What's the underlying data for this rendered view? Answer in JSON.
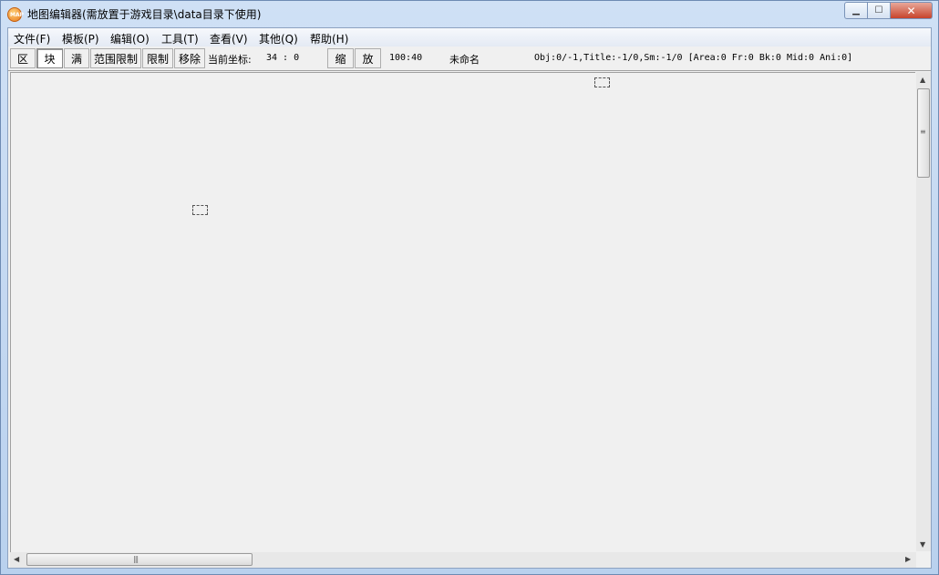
{
  "window": {
    "title": "地图编辑器(需放置于游戏目录\\data目录下使用)",
    "app_icon_text": "MAP",
    "minimize_glyph": "▁",
    "maximize_glyph": "☐",
    "close_glyph": "✕"
  },
  "menu": {
    "items": [
      {
        "label": "文件(F)"
      },
      {
        "label": "模板(P)"
      },
      {
        "label": "编辑(O)"
      },
      {
        "label": "工具(T)"
      },
      {
        "label": "查看(V)"
      },
      {
        "label": "其他(Q)"
      },
      {
        "label": "帮助(H)"
      }
    ]
  },
  "toolbar": {
    "zone_label": "区",
    "block_label": "块",
    "full_label": "满",
    "range_limit_label": "范围限制",
    "limit_label": "限制",
    "remove_label": "移除",
    "coord_caption": "当前坐标:",
    "coord_value": "34 : 0",
    "shrink_label": "缩",
    "enlarge_label": "放",
    "zoom_value": "100:40",
    "file_name": "未命名",
    "stats": "Obj:0/-1,Title:-1/0,Sm:-1/0 [Area:0 Fr:0 Bk:0 Mid:0 Ani:0]"
  },
  "scrollbars": {
    "up_arrow": "▲",
    "down_arrow": "▼",
    "left_arrow": "◀",
    "right_arrow": "▶",
    "grip": "≡",
    "hgrip": "|||"
  }
}
